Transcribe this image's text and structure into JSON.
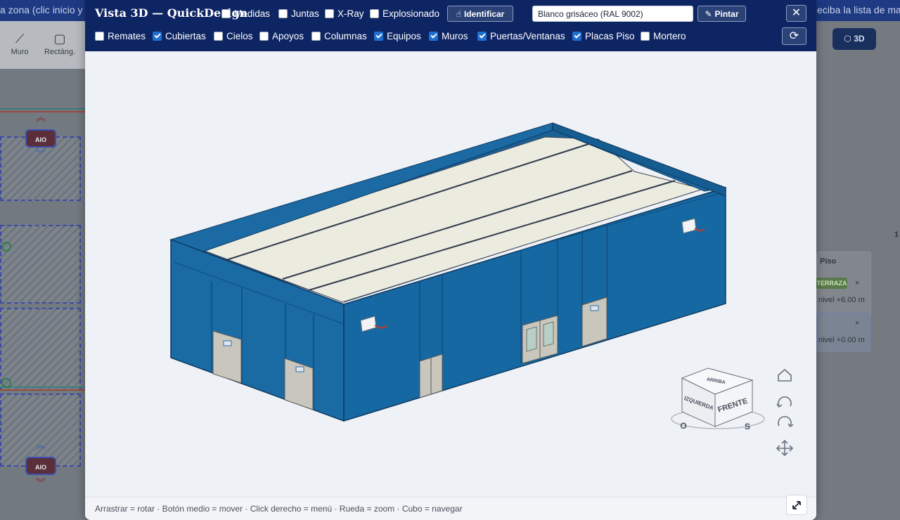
{
  "background": {
    "topbar_left_text": "a zona (clic inicio y c",
    "topbar_right_text": "eciba la lista de ma",
    "tools": [
      {
        "label": "Muro",
        "icon": "diagonal-line-icon"
      },
      {
        "label": "Rectáng.",
        "icon": "rectangle-icon"
      }
    ],
    "aio_labels": [
      "AIO",
      "AIO"
    ],
    "btn_3d_label": "3D",
    "right_panel": {
      "header": "Piso",
      "badge": "TERRAZA",
      "items": [
        "nivel +6.00 m",
        "nivel +0.00 m"
      ],
      "remove_glyph": "×",
      "snippet_number": "1"
    }
  },
  "modal": {
    "title": "Vista 3D — QuickDesign",
    "top_toggles": [
      {
        "label": "Medidas",
        "checked": false
      },
      {
        "label": "Juntas",
        "checked": false
      },
      {
        "label": "X-Ray",
        "checked": false
      },
      {
        "label": "Explosionado",
        "checked": false
      }
    ],
    "identify_label": "Identificar",
    "color_value": "Blanco grisáceo (RAL 9002)",
    "paint_label": "Pintar",
    "close_glyph": "✕",
    "layer_toggles": [
      {
        "label": "Remates",
        "checked": false
      },
      {
        "label": "Cubiertas",
        "checked": true
      },
      {
        "label": "Cielos",
        "checked": false
      },
      {
        "label": "Apoyos",
        "checked": false
      },
      {
        "label": "Columnas",
        "checked": false
      },
      {
        "label": "Equipos",
        "checked": true
      },
      {
        "label": "Muros",
        "checked": true
      },
      {
        "label": "Puertas/Ventanas",
        "checked": true
      },
      {
        "label": "Placas Piso",
        "checked": true
      },
      {
        "label": "Mortero",
        "checked": false
      }
    ],
    "nav_cube": {
      "top": "ARRIBA",
      "left": "IZQUIERDA",
      "front": "FRENTE",
      "compass_o": "O",
      "compass_s": "S"
    },
    "hint": "Arrastrar = rotar · Botón medio = mover · Click derecho = menú · Rueda = zoom · Cubo = navegar",
    "colors": {
      "header": "#0e2564",
      "wall": "#1a6faa",
      "wall_dark": "#135a8c",
      "roof": "#eeeee2",
      "door": "#c9c6bd"
    }
  }
}
